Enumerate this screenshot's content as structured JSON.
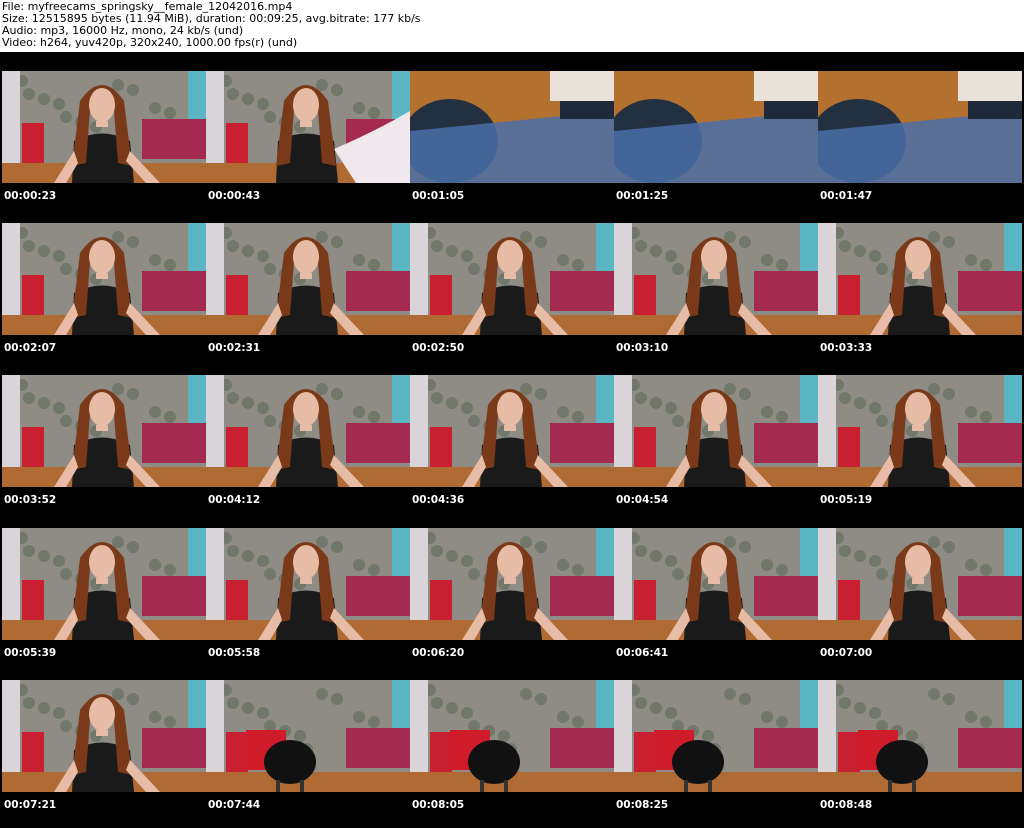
{
  "header": {
    "file": "File: myfreecams_springsky__female_12042016.mp4",
    "size": "Size: 12515895 bytes (11.94 MiB), duration: 00:09:25, avg.bitrate: 177 kb/s",
    "audio": "Audio: mp3, 16000 Hz, mono, 24 kb/s (und)",
    "video": "Video: h264, yuv420p, 320x240, 1000.00 fps(r) (und)"
  },
  "thumbnails": [
    {
      "time": "00:00:23",
      "scene": "person"
    },
    {
      "time": "00:00:43",
      "scene": "person-reaching"
    },
    {
      "time": "00:01:05",
      "scene": "laptop"
    },
    {
      "time": "00:01:25",
      "scene": "laptop"
    },
    {
      "time": "00:01:47",
      "scene": "laptop"
    },
    {
      "time": "00:02:07",
      "scene": "person"
    },
    {
      "time": "00:02:31",
      "scene": "person"
    },
    {
      "time": "00:02:50",
      "scene": "person"
    },
    {
      "time": "00:03:10",
      "scene": "person"
    },
    {
      "time": "00:03:33",
      "scene": "person"
    },
    {
      "time": "00:03:52",
      "scene": "person"
    },
    {
      "time": "00:04:12",
      "scene": "person"
    },
    {
      "time": "00:04:36",
      "scene": "person"
    },
    {
      "time": "00:04:54",
      "scene": "person"
    },
    {
      "time": "00:05:19",
      "scene": "person"
    },
    {
      "time": "00:05:39",
      "scene": "person"
    },
    {
      "time": "00:05:58",
      "scene": "person"
    },
    {
      "time": "00:06:20",
      "scene": "person"
    },
    {
      "time": "00:06:41",
      "scene": "person"
    },
    {
      "time": "00:07:00",
      "scene": "person"
    },
    {
      "time": "00:07:21",
      "scene": "person"
    },
    {
      "time": "00:07:44",
      "scene": "empty-room"
    },
    {
      "time": "00:08:05",
      "scene": "empty-room"
    },
    {
      "time": "00:08:25",
      "scene": "empty-room"
    },
    {
      "time": "00:08:48",
      "scene": "empty-room"
    }
  ],
  "colors": {
    "background": "#000000",
    "header_bg": "#ffffff",
    "timestamp": "#ffffff",
    "curtain": "#8f8c86",
    "bed": "#a52a52",
    "wall": "#5bb6c4",
    "hair": "#7a3a1a",
    "shirt": "#1a1a1a",
    "floor": "#b06a34",
    "desk": "#b4702e",
    "screen": "#4a6ea8"
  }
}
